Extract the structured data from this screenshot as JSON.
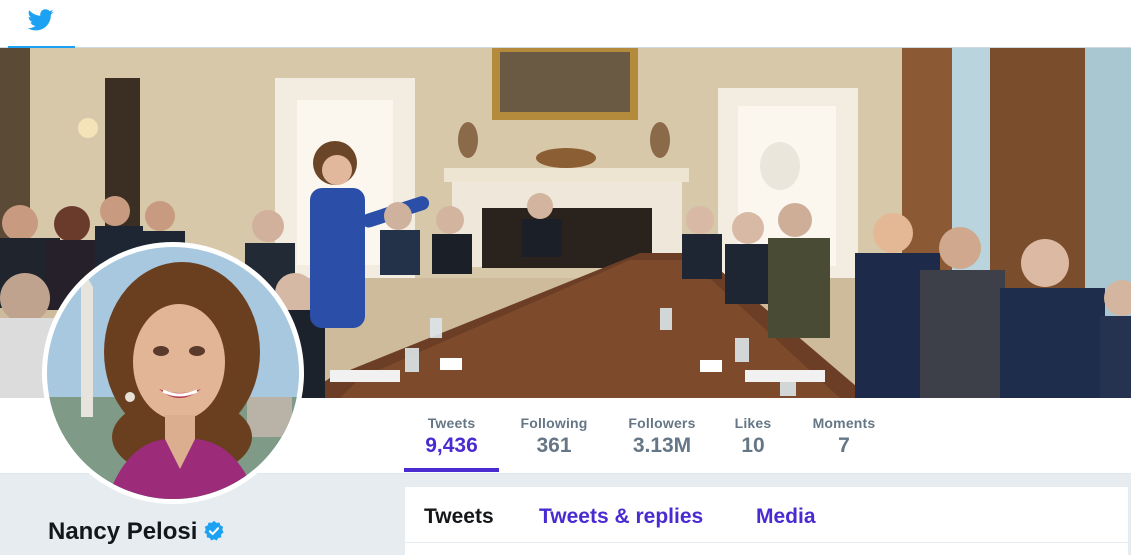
{
  "nav": {
    "home_icon": "bird-icon",
    "brand_color": "#1da1f2"
  },
  "stats": [
    {
      "label": "Tweets",
      "value": "9,436",
      "active": true
    },
    {
      "label": "Following",
      "value": "361"
    },
    {
      "label": "Followers",
      "value": "3.13M"
    },
    {
      "label": "Likes",
      "value": "10"
    },
    {
      "label": "Moments",
      "value": "7"
    }
  ],
  "profile": {
    "name": "Nancy Pelosi",
    "verified_icon": "verified-badge-icon"
  },
  "timeline_tabs": [
    {
      "label": "Tweets",
      "active": true
    },
    {
      "label": "Tweets & replies"
    },
    {
      "label": "Media"
    }
  ],
  "colors": {
    "accent": "#4a2bd1",
    "muted": "#657786",
    "verified": "#1da1f2",
    "background": "#e6ecf0"
  }
}
